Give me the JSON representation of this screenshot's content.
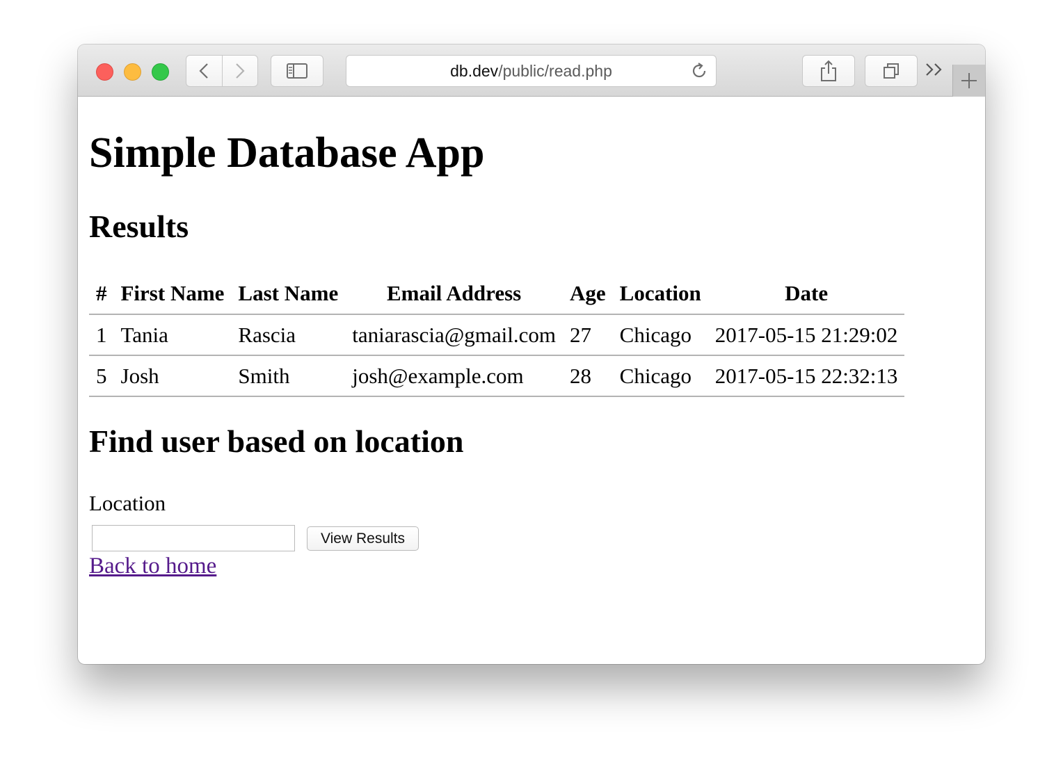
{
  "browser": {
    "url_host": "db.dev",
    "url_path": "/public/read.php"
  },
  "page": {
    "title": "Simple Database App",
    "results_heading": "Results",
    "table": {
      "columns": [
        "#",
        "First Name",
        "Last Name",
        "Email Address",
        "Age",
        "Location",
        "Date"
      ],
      "rows": [
        {
          "id": "1",
          "first_name": "Tania",
          "last_name": "Rascia",
          "email": "taniarascia@gmail.com",
          "age": "27",
          "location": "Chicago",
          "date": "2017-05-15 21:29:02"
        },
        {
          "id": "5",
          "first_name": "Josh",
          "last_name": "Smith",
          "email": "josh@example.com",
          "age": "28",
          "location": "Chicago",
          "date": "2017-05-15 22:32:13"
        }
      ]
    },
    "find_heading": "Find user based on location",
    "location_label": "Location",
    "location_value": "",
    "view_button": "View Results",
    "back_link": "Back to home"
  },
  "colors": {
    "link_visited": "#551a8b",
    "close": "#fc605c",
    "minimize": "#fdbc40",
    "zoom": "#34c84a"
  }
}
